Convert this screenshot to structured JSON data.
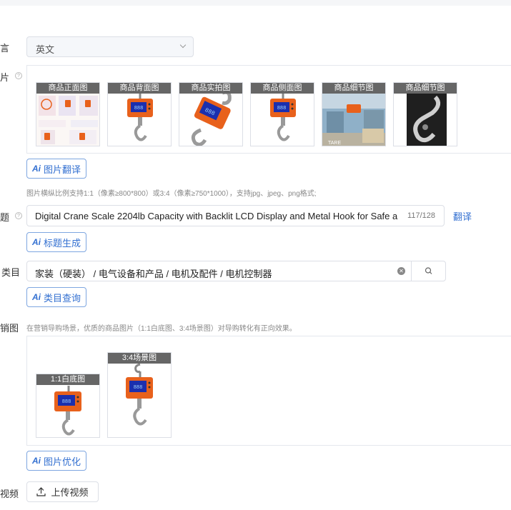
{
  "language": {
    "label": "言",
    "value": "英文"
  },
  "images": {
    "label": "片",
    "thumbnails": [
      {
        "caption": "商品正面图",
        "kind": "grid"
      },
      {
        "caption": "商品背面图",
        "kind": "scale"
      },
      {
        "caption": "商品实拍图",
        "kind": "scale-tilt"
      },
      {
        "caption": "商品侧面图",
        "kind": "scale"
      },
      {
        "caption": "商品细节图",
        "kind": "factory"
      },
      {
        "caption": "商品细节图",
        "kind": "hook"
      }
    ],
    "translate_label": "图片翻译",
    "hint": "图片横纵比例支持1:1（像素≥800*800）或3:4（像素≥750*1000），支持jpg、jpeg、png格式;"
  },
  "title": {
    "label": "题",
    "value": "Digital Crane Scale 2204lb Capacity with Backlit LCD Display and Metal Hook for Safe and A",
    "count": "117/128",
    "translate_link": "翻译",
    "generate_label": "标题生成"
  },
  "category": {
    "label": "类目",
    "value": "家装（硬装） / 电气设备和产品 / 电机及配件 / 电机控制器",
    "query_label": "类目查询"
  },
  "marketing": {
    "label": "销图",
    "hint": "在营销导购场景，优质的商品图片（1:1白底图、3:4场景图）对导购转化有正向效果。",
    "thumbnails": [
      {
        "caption": "1:1白底图"
      },
      {
        "caption": "3:4场景图"
      }
    ],
    "optimize_label": "图片优化"
  },
  "video": {
    "label": "视频",
    "upload_label": "上传视频"
  },
  "ai_badge": "Ai",
  "colors": {
    "accent": "#3370d1",
    "scale_orange": "#e8611c",
    "lcd": "#1b2fae"
  }
}
